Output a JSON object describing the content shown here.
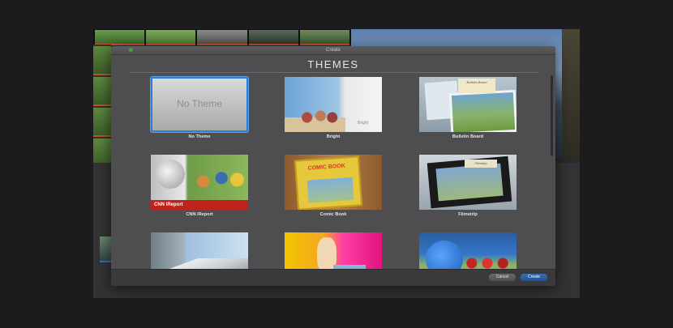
{
  "window": {
    "title": "Create"
  },
  "dialog": {
    "heading": "THEMES",
    "themes": [
      {
        "label": "No Theme",
        "thumb_text": "No Theme",
        "selected": true
      },
      {
        "label": "Bright",
        "thumb_text": "Bright"
      },
      {
        "label": "Bulletin Board",
        "thumb_text": "Bulletin Board"
      },
      {
        "label": "CNN iReport",
        "thumb_text": "CNN iReport"
      },
      {
        "label": "Comic Book",
        "thumb_text": "COMIC BOOK"
      },
      {
        "label": "Filmstrip",
        "thumb_text": "Filmstrip"
      },
      {
        "label": ""
      },
      {
        "label": ""
      },
      {
        "label": ""
      }
    ],
    "buttons": {
      "cancel": "Cancel",
      "create": "Create"
    }
  },
  "colors": {
    "selection": "#2d7fd6",
    "create_button": "#2f5fa0",
    "dialog_bg": "#4e4e50",
    "cnn_red": "#c0211b"
  }
}
